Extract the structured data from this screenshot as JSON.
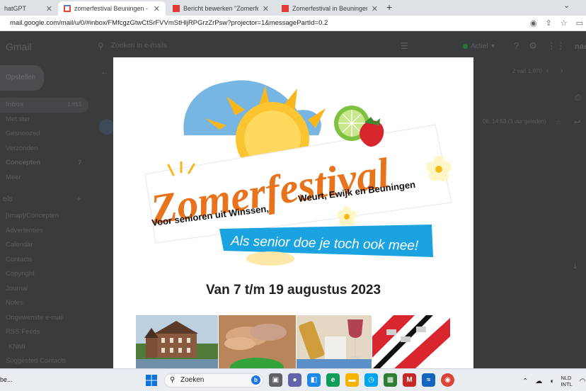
{
  "browser": {
    "tabs": [
      {
        "title": "hatGPT",
        "active": false
      },
      {
        "title": "zomerfestival Beuningen - beuningen",
        "active": true
      },
      {
        "title": "Bericht bewerken \"Zomerfestival",
        "active": false
      },
      {
        "title": "Zomerfestival in Beuningen: Senio",
        "active": false
      }
    ],
    "new_tab_label": "+",
    "url": "mail.google.com/mail/u/0/#inbox/FMfcgzGtwCtSrFVVmStHljRPGrzZrPsw?projector=1&messagePartId=0.2"
  },
  "gmail": {
    "logo": "Gmail",
    "search_placeholder": "Zoeken in e-mails",
    "status": "Actief",
    "brand": "nae",
    "compose": "Opstellen",
    "nav": [
      {
        "label": "Inbox",
        "count": "1.913",
        "bold": true,
        "selected": true
      },
      {
        "label": "Met ster",
        "count": "",
        "bold": false,
        "selected": false
      },
      {
        "label": "Gesnoozed",
        "count": "",
        "bold": false,
        "selected": false
      },
      {
        "label": "Verzonden",
        "count": "",
        "bold": false,
        "selected": false
      },
      {
        "label": "Concepten",
        "count": "7",
        "bold": true,
        "selected": false
      },
      {
        "label": "Meer",
        "count": "",
        "bold": false,
        "selected": false
      }
    ],
    "labels_header": "els",
    "labels": [
      {
        "label": "[Imap]/Concepten",
        "sub": false
      },
      {
        "label": "Advertenties",
        "sub": false
      },
      {
        "label": "Calendar",
        "sub": false
      },
      {
        "label": "Contacts",
        "sub": false
      },
      {
        "label": "Copyright",
        "sub": false
      },
      {
        "label": "Journal",
        "sub": false
      },
      {
        "label": "Notes",
        "sub": false
      },
      {
        "label": "Ongewenste e-mail",
        "sub": false
      },
      {
        "label": "RSS Feeds",
        "sub": false
      },
      {
        "label": "KNMI",
        "sub": true
      },
      {
        "label": "Suggested Contacts",
        "sub": false
      }
    ],
    "pager": "2 van 1.970",
    "message_time": "08: 14:53 (3 uur geleden)"
  },
  "poster": {
    "title": "Zomerfestival",
    "subtitle_left": "Voor senioren uit Winssen,",
    "subtitle_right": "Weurt, Ewijk en Beuningen",
    "slogan": "Als senior doe je toch ook mee!",
    "dates": "Van 7 t/m 19 augustus 2023"
  },
  "taskbar": {
    "left_text": "be...",
    "search_label": "Zoeken",
    "bing_label": "b",
    "lang_line1": "NLD",
    "lang_line2": "INTL"
  },
  "colors": {
    "orange": "#e8731c",
    "blue_banner": "#1aa3e0",
    "sun_yellow": "#f9b51c",
    "sky_blue": "#5fa9dd"
  }
}
